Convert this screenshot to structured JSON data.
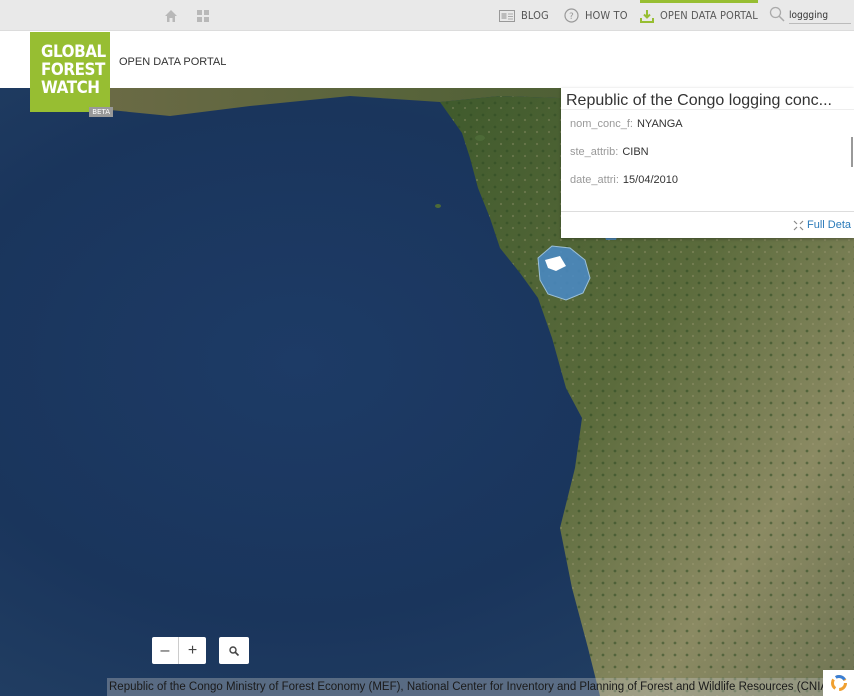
{
  "topnav": {
    "blog_label": "BLOG",
    "howto_label": "HOW TO",
    "odp_label": "OPEN DATA PORTAL",
    "search_value": "loggging",
    "accent": "#97be32"
  },
  "header": {
    "logo_line1": "GLOBAL",
    "logo_line2": "FOREST",
    "logo_line3": "WATCH",
    "logo_beta": "BETA",
    "portal_label": "OPEN DATA PORTAL"
  },
  "popup": {
    "title": "Republic of the Congo logging conc...",
    "fields": [
      {
        "key": "nom_conc_f:",
        "value": "NYANGA"
      },
      {
        "key": "ste_attrib:",
        "value": "CIBN"
      },
      {
        "key": "date_attri:",
        "value": "15/04/2010"
      }
    ],
    "full_details": "Full Deta"
  },
  "zoom": {
    "minus": "–",
    "plus": "+"
  },
  "attribution": "Republic of the Congo Ministry of Forest Economy (MEF), National Center for Inventory and Planning of Forest and Wildlife Resources (CNIA",
  "icons": {
    "home": "home-icon",
    "apps": "apps-grid-icon",
    "blog": "blog-icon",
    "howto": "help-circle-icon",
    "download": "download-icon",
    "search": "search-icon",
    "zoom_box": "zoom-box-icon",
    "full_details": "expand-icon",
    "loader": "loader-icon"
  }
}
